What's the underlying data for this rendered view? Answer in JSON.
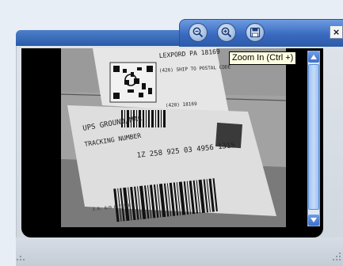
{
  "toolbar": {
    "zoom_out_icon": "zoom-out-icon",
    "zoom_in_icon": "zoom-in-icon",
    "save_icon": "save-icon",
    "close_label": "×"
  },
  "tooltip": {
    "text": "Zoom In (Ctrl +)"
  },
  "label": {
    "shipper_line": "LEXPORD PA 18169",
    "ship_to": "(426) SHIP TO POSTAL CODE",
    "small_code": "(420) 18169",
    "service": "UPS GROUND/MAC",
    "tracking_label": "TRACKING NUMBER",
    "tracking_number": "1Z 258 925 03 4956 1315",
    "footer": "I.S. 8/0 6.77368"
  },
  "colors": {
    "accent_blue": "#3a6ac0",
    "viewer_bg": "#000000",
    "tooltip_bg": "#ffffe1"
  }
}
